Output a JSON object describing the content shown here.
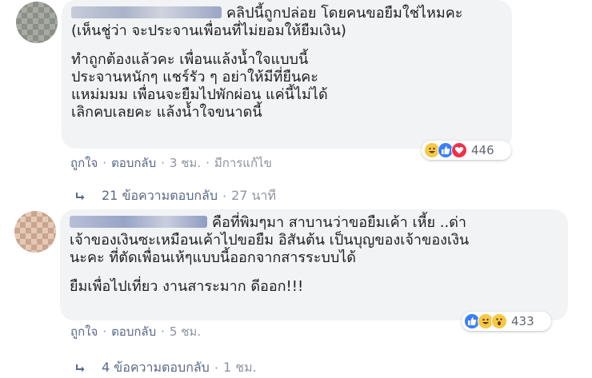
{
  "comments": [
    {
      "first_line": "คลิปนี้ถูกปล่อย โดยคนขอยืมใช่ไหมคะ",
      "para1_rest": "(เห็นชู่ว่า จะประจานเพื่อนที่ไม่ยอมให้ยืมเงิน)",
      "para2": "ทำถูกต้องแล้วคะ เพื่อนแล้งน้ำใจแบบนี้\nประจานหนักๆ แชร์รัว ๆ อย่าให้มีที่ยืนคะ\nแหม่มมม เพื่อนจะยืมไปพักผ่อน แค่นี้ไม่ได้\nเลิกคบเลยคะ แล้งน้ำใจขนาดนี้",
      "reactions": {
        "icons": [
          "haha-icon",
          "like-icon",
          "love-icon"
        ],
        "count": "446"
      },
      "actions": {
        "like": "ถูกใจ",
        "reply": "ตอบกลับ",
        "time": "3 ชม.",
        "edited": "มีการแก้ไข"
      },
      "replies": {
        "label": "21 ข้อความตอบกลับ",
        "time": "27 นาที"
      }
    },
    {
      "first_line": "คือที่พิมๆมา สาบานว่าขอยืมเค้า เหี้ย ..ด่า",
      "para1_rest": "เจ้าของเงินซะเหมือนเค้าไปขอยืม อิสันต้น เป็นบุญของเจ้าของเงิน\nนะคะ ที่ตัดเพื่อนเห้ๆแบบนี้ออกจากสารระบบได้",
      "para2": "ยืมเพื่อไปเที่ยว งานสาระมาก ดีออก!!!",
      "reactions": {
        "icons": [
          "like-icon",
          "haha-icon",
          "wow-icon"
        ],
        "count": "433"
      },
      "actions": {
        "like": "ถูกใจ",
        "reply": "ตอบกลับ",
        "time": "5 ชม."
      },
      "replies": {
        "label": "4 ข้อความตอบกลับ",
        "time": "1 ชม."
      }
    }
  ],
  "colors": {
    "bubble": "#f2f3f5",
    "link": "#5b6986",
    "meta": "#8d949e",
    "like": "#3b80f7",
    "love": "#f0304a",
    "haha": "#f7c847"
  }
}
